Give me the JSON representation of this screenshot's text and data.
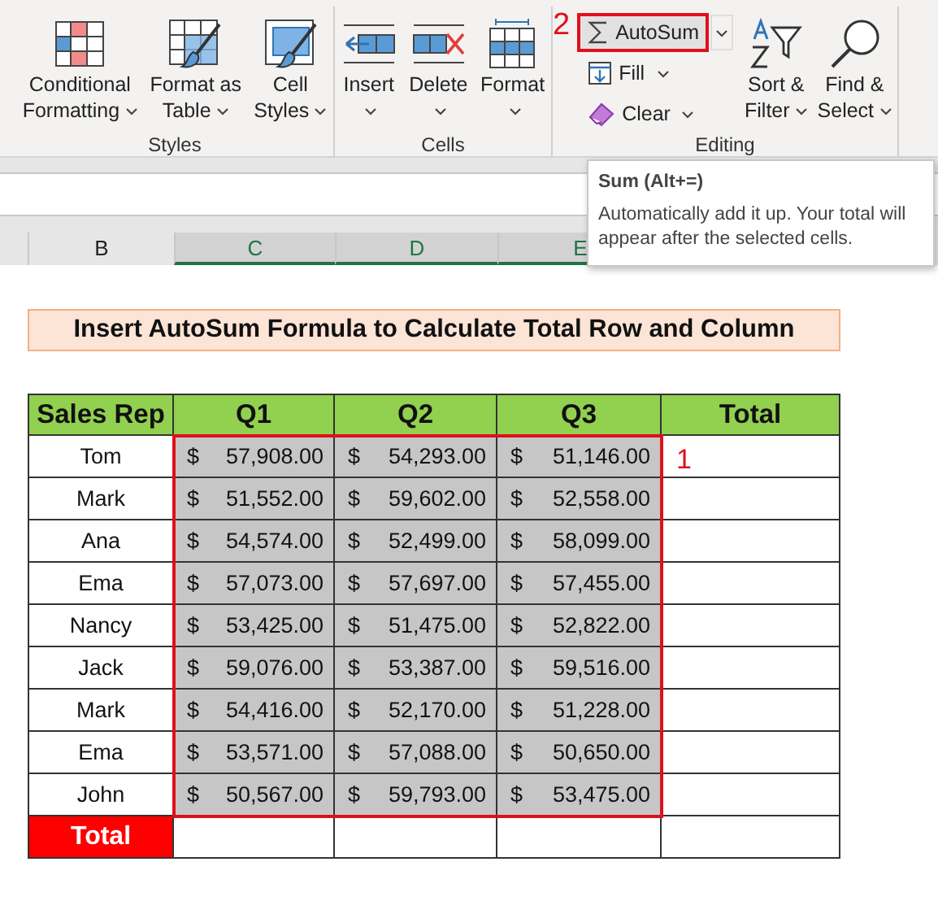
{
  "ribbon": {
    "step_marker": "2",
    "groups": [
      {
        "label": "Styles",
        "buttons": [
          {
            "kind": "large",
            "lines": [
              "Conditional",
              "Formatting"
            ]
          },
          {
            "kind": "large",
            "lines": [
              "Format as",
              "Table"
            ]
          },
          {
            "kind": "large",
            "lines": [
              "Cell",
              "Styles"
            ]
          }
        ]
      },
      {
        "label": "Cells",
        "buttons": [
          {
            "kind": "large",
            "lines": [
              "Insert"
            ]
          },
          {
            "kind": "large",
            "lines": [
              "Delete"
            ]
          },
          {
            "kind": "large",
            "lines": [
              "Format"
            ]
          }
        ]
      },
      {
        "label": "Editing",
        "buttons": [
          {
            "kind": "stack",
            "items": [
              {
                "label": "AutoSum",
                "highlighted": true,
                "split": true
              },
              {
                "label": "Fill",
                "highlighted": false,
                "split": false
              },
              {
                "label": "Clear",
                "highlighted": false,
                "split": false
              }
            ]
          },
          {
            "kind": "large",
            "lines": [
              "Sort &",
              "Filter"
            ]
          },
          {
            "kind": "large",
            "lines": [
              "Find &",
              "Select"
            ]
          }
        ]
      }
    ]
  },
  "column_headers": [
    {
      "label": "B",
      "selected": false
    },
    {
      "label": "C",
      "selected": true
    },
    {
      "label": "D",
      "selected": true
    },
    {
      "label": "E",
      "selected": true
    }
  ],
  "sheet_title": "Insert AutoSum Formula to Calculate Total Row and Column",
  "table": {
    "columns": [
      "Sales Rep",
      "Q1",
      "Q2",
      "Q3",
      "Total"
    ],
    "rows": [
      {
        "name": "Tom",
        "values": [
          "57,908.00",
          "54,293.00",
          "51,146.00"
        ]
      },
      {
        "name": "Mark",
        "values": [
          "51,552.00",
          "59,602.00",
          "52,558.00"
        ]
      },
      {
        "name": "Ana",
        "values": [
          "54,574.00",
          "52,499.00",
          "58,099.00"
        ]
      },
      {
        "name": "Ema",
        "values": [
          "57,073.00",
          "57,697.00",
          "57,455.00"
        ]
      },
      {
        "name": "Nancy",
        "values": [
          "53,425.00",
          "51,475.00",
          "52,822.00"
        ]
      },
      {
        "name": "Jack",
        "values": [
          "59,076.00",
          "53,387.00",
          "59,516.00"
        ]
      },
      {
        "name": "Mark",
        "values": [
          "54,416.00",
          "52,170.00",
          "51,228.00"
        ]
      },
      {
        "name": "Ema",
        "values": [
          "53,571.00",
          "57,088.00",
          "50,650.00"
        ]
      },
      {
        "name": "John",
        "values": [
          "50,567.00",
          "59,793.00",
          "53,475.00"
        ]
      }
    ],
    "currency": "$",
    "total_label": "Total",
    "step_marker": "1"
  },
  "tooltip": {
    "title": "Sum (Alt+=)",
    "text": "Automatically add it up. Your total will appear after the selected cells."
  }
}
